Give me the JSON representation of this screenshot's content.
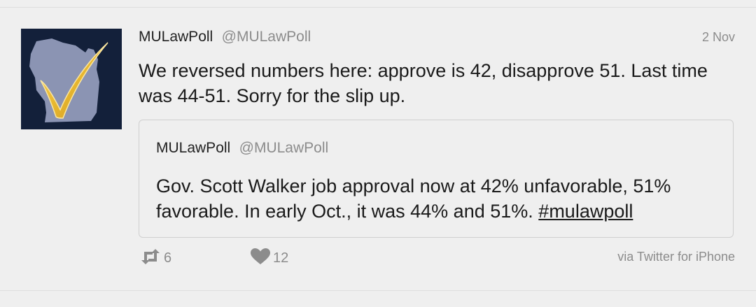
{
  "tweet": {
    "author": {
      "display_name": "MULawPoll",
      "handle": "@MULawPoll"
    },
    "date": "2 Nov",
    "text": "We reversed numbers here: approve is 42, disapprove 51. Last time was 44-51. Sorry for the slip up.",
    "quoted": {
      "display_name": "MULawPoll",
      "handle": "@MULawPoll",
      "text": "Gov. Scott Walker job approval now at 42% unfavorable, 51% favorable. In early Oct., it was 44% and 51%.",
      "hashtag": "#mulawpoll"
    },
    "actions": {
      "retweet_count": "6",
      "like_count": "12",
      "retweet_icon": "retweet-icon",
      "like_icon": "heart-icon"
    },
    "source": "via Twitter for iPhone"
  },
  "colors": {
    "background": "#efefef",
    "avatar_bg": "#13203a",
    "avatar_state": "#8b94b3",
    "checkmark": "#e8b830",
    "muted_text": "#8c8c8c"
  }
}
